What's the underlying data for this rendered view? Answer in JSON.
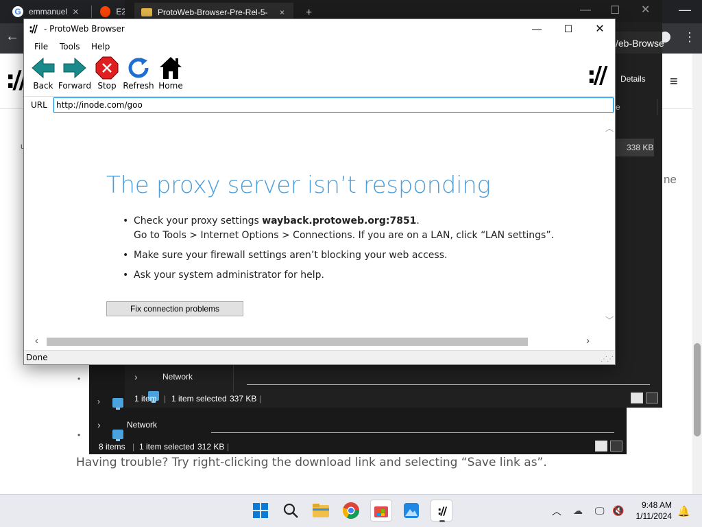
{
  "chrome": {
    "tabs": [
      {
        "label": "emmanuel",
        "icon": "google-icon"
      },
      {
        "label": "E2",
        "icon": "reddit-icon"
      }
    ],
    "page_bottom_text": "Having trouble? Try right-clicking the download link and selecting “Save link as”.",
    "partial_text_right": "ne",
    "details_label": "Details"
  },
  "explorer_front": {
    "tab_title": "ProtoWeb-Browser-Pre-Rel-5-",
    "address_partial": "/eb-Browse",
    "file_size": "338 KB",
    "column_partial": "e",
    "network_label": "Network",
    "status": {
      "items": "1 item",
      "selected": "1 item selected",
      "size": "337 KB"
    }
  },
  "explorer_back": {
    "network_label": "Network",
    "status": {
      "items": "8 items",
      "selected": "1 item selected",
      "size": "312 KB"
    }
  },
  "protoweb": {
    "window_title": "- ProtoWeb Browser",
    "logo": "://",
    "menu": [
      "File",
      "Tools",
      "Help"
    ],
    "toolbar": [
      {
        "label": "Back",
        "icon": "back-arrow-icon"
      },
      {
        "label": "Forward",
        "icon": "forward-arrow-icon"
      },
      {
        "label": "Stop",
        "icon": "stop-icon"
      },
      {
        "label": "Refresh",
        "icon": "refresh-icon"
      },
      {
        "label": "Home",
        "icon": "home-icon"
      }
    ],
    "url_label": "URL",
    "url_value": "http://inode.com/goo",
    "error": {
      "heading": "The proxy server isn’t responding",
      "item1_prefix": "Check your proxy settings ",
      "item1_bold": "wayback.protoweb.org:7851",
      "item1_suffix": ".",
      "item1_line2": "Go to Tools > Internet Options > Connections. If you are on a LAN, click “LAN settings”.",
      "item2": "Make sure your firewall settings aren’t blocking your web access.",
      "item3": "Ask your system administrator for help.",
      "button": "Fix connection problems"
    },
    "status": "Done"
  },
  "taskbar": {
    "apps": [
      "start-icon",
      "search-icon",
      "file-explorer-icon",
      "chrome-icon",
      "store-icon",
      "photos-icon",
      "protoweb-icon"
    ],
    "time": "9:48 AM",
    "date": "1/11/2024"
  },
  "colors": {
    "heading_blue": "#4e9ed8",
    "arrow_teal": "#1a8a8a",
    "stop_red": "#e02020",
    "refresh_blue": "#1e6fd0"
  }
}
